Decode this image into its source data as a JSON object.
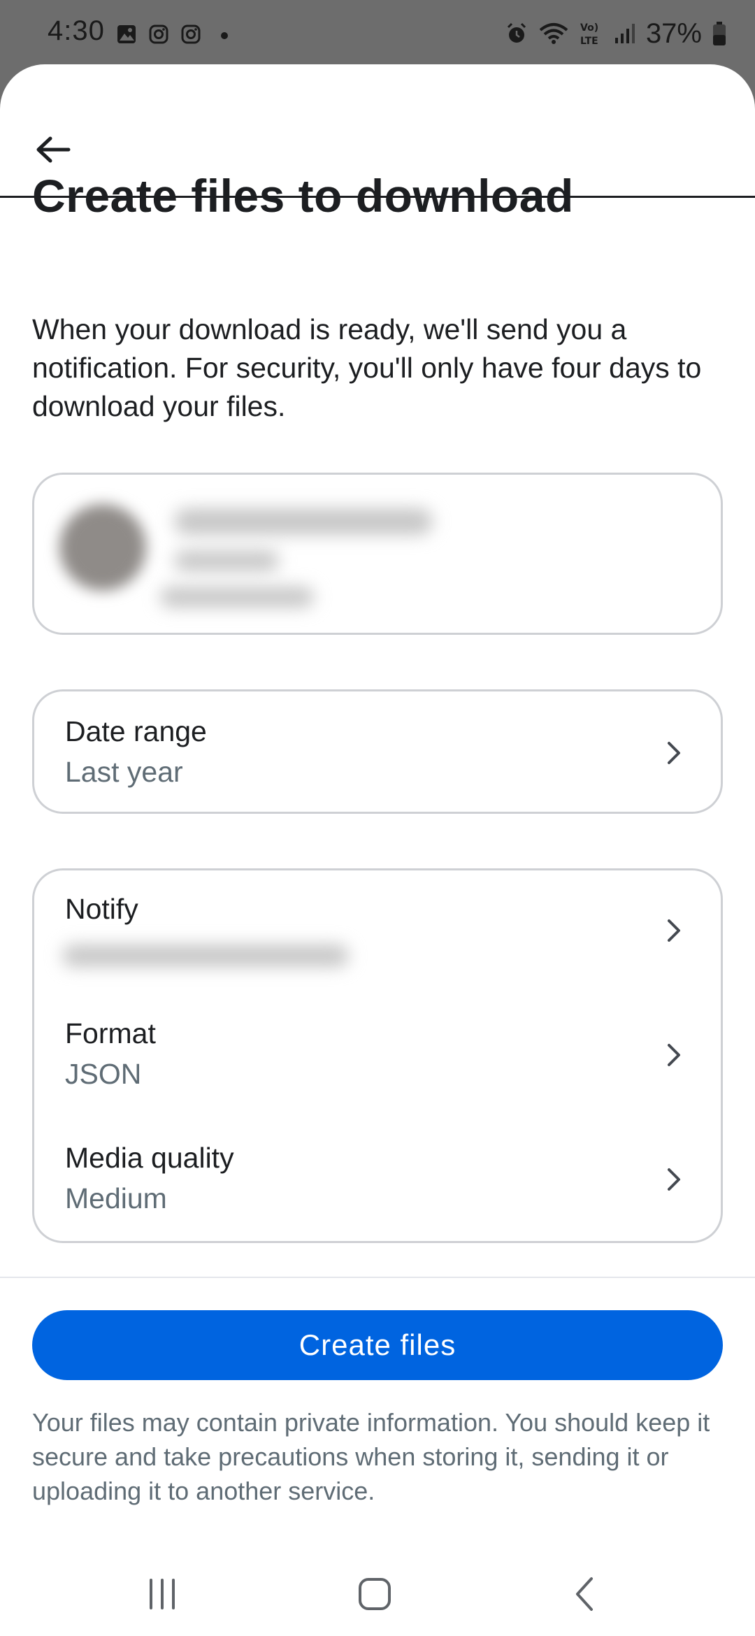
{
  "status_bar": {
    "time": "4:30",
    "battery": "37%",
    "icons": [
      "image-icon",
      "instagram-icon",
      "instagram-icon",
      "dot-icon",
      "alarm-icon",
      "wifi-icon",
      "volte-icon",
      "signal-icon",
      "battery-icon"
    ]
  },
  "header": {
    "back_icon": "arrow-left-icon"
  },
  "title": "Create files to download",
  "intro": "When your download is ready, we'll send you a notification. For security, you'll only have four days to download your files.",
  "date_range": {
    "label": "Date range",
    "value": "Last year"
  },
  "options": {
    "notify_label": "Notify",
    "format_label": "Format",
    "format_value": "JSON",
    "quality_label": "Media quality",
    "quality_value": "Medium"
  },
  "create_button": "Create files",
  "disclaimer": "Your files may contain private information. You should keep it secure and take precautions when storing it, sending it or uploading it to another service.",
  "colors": {
    "accent": "#0064e0",
    "secondary_text": "#5f6c75",
    "border": "#ced0d4"
  }
}
